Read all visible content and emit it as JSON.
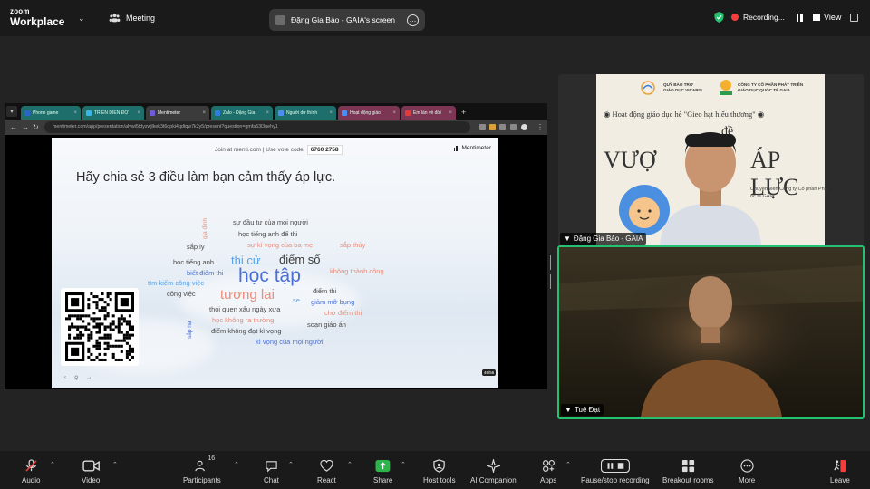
{
  "app": {
    "logo_line1": "zoom",
    "logo_line2": "Workplace",
    "meeting_label": "Meeting"
  },
  "share": {
    "title": "Đặng Gia Bảo - GAIA's screen"
  },
  "recording": {
    "label": "Recording..."
  },
  "view": {
    "label": "View"
  },
  "browser": {
    "tabs": [
      {
        "label": "Phone game",
        "style": "teal",
        "fav": "#2d64c8"
      },
      {
        "label": "TRIỂN DIỄN ĐỢ",
        "style": "teal",
        "fav": "#3ab5e6"
      },
      {
        "label": "Mentimeter",
        "style": "active",
        "fav": "#6f5ad8"
      },
      {
        "label": "Zalo - Đặng Gia",
        "style": "teal",
        "fav": "#2f7de0"
      },
      {
        "label": "Người dự thính",
        "style": "teal",
        "fav": "#4b8df0"
      },
      {
        "label": "Hoạt động giáo",
        "style": "pink",
        "fav": "#4b8df0"
      },
      {
        "label": "Em lần về đời",
        "style": "pink",
        "fav": "#e23b3b"
      }
    ],
    "url": "mentimeter.com/app/presentation/alvwi5tdyzwjlkek3t6opki4qdtqw7k2y5/present?question=qmfa53l3uehy1"
  },
  "slide": {
    "join_text": "Join at menti.com | Use vote code",
    "vote_code": "6760 2758",
    "brand": "Mentimeter",
    "question": "Hãy chia sẻ 3 điều làm bạn cảm thấy áp lực.",
    "page_indicator": "46/56",
    "words": [
      {
        "text": "sự đầu tư của mọi người",
        "color": "#4a4a4a"
      },
      {
        "text": "học tiếng anh để thi",
        "color": "#4a4a4a"
      },
      {
        "text": "sự kì vọng của ba mẹ",
        "color": "#e98b7a"
      },
      {
        "text": "sắp thủy",
        "color": "#e98b7a"
      },
      {
        "text": "sắp ly",
        "color": "#4a4a4a"
      },
      {
        "text": "thi cử",
        "color": "#5aa0e6"
      },
      {
        "text": "điểm số",
        "color": "#3b3b3b"
      },
      {
        "text": "học tiếng anh",
        "color": "#4a4a4a"
      },
      {
        "text": "biết điểm thi",
        "color": "#4a70d8"
      },
      {
        "text": "không thành công",
        "color": "#e98b7a"
      },
      {
        "text": "học tập",
        "color": "#4a70d8"
      },
      {
        "text": "tìm kiếm công việc",
        "color": "#5aa0e6"
      },
      {
        "text": "công việc",
        "color": "#4a4a4a"
      },
      {
        "text": "tương lai",
        "color": "#e98b7a"
      },
      {
        "text": "se",
        "color": "#5aa0e6"
      },
      {
        "text": "điểm thi",
        "color": "#4a4a4a"
      },
      {
        "text": "giảm mỡ bụng",
        "color": "#4a70d8"
      },
      {
        "text": "thói quen xấu ngày xưa",
        "color": "#4a4a4a"
      },
      {
        "text": "chờ điểm thi",
        "color": "#e98b7a"
      },
      {
        "text": "học không ra trường",
        "color": "#e98b7a"
      },
      {
        "text": "soạn giáo án",
        "color": "#4a4a4a"
      },
      {
        "text": "điểm không đạt kì vọng",
        "color": "#4a4a4a"
      },
      {
        "text": "kì vọng của mọi người",
        "color": "#4a70d8"
      },
      {
        "text": "gia đình",
        "color": "#e98b7a"
      },
      {
        "text": "sắp hạ",
        "color": "#4a70d8"
      }
    ]
  },
  "participants": [
    {
      "name": "Đặng Gia Bảo - GAIA",
      "banner": {
        "org_left": "QUỸ BẢO TRỢ\nGIÁO DỤC VICARIS",
        "org_right": "CÔNG TY CỔ PHẦN PHÁT TRIỂN\nGIÁO DỤC QUỐC TẾ GAIA",
        "event": "Hoạt động giáo dục hè \"Gieo hạt hiếu thương\"",
        "topic_word": "đề",
        "title_left": "VƯỢ",
        "title_right": "ÁP LỰC",
        "speaker_line1": "Chuyên viên Công ty Cổ phần Phá",
        "speaker_line2": "ốc tế GAIA"
      }
    },
    {
      "name": "Tuệ Đạt"
    }
  ],
  "toolbar": {
    "audio": "Audio",
    "video": "Video",
    "participants": "Participants",
    "participants_count": "16",
    "chat": "Chat",
    "react": "React",
    "share": "Share",
    "host_tools": "Host tools",
    "ai_companion": "AI Companion",
    "apps": "Apps",
    "pause_recording": "Pause/stop recording",
    "breakout": "Breakout rooms",
    "more": "More",
    "leave": "Leave"
  },
  "colors": {
    "accent_green": "#25c26e",
    "share_green": "#2cb64a",
    "record_red": "#f53d3d"
  }
}
